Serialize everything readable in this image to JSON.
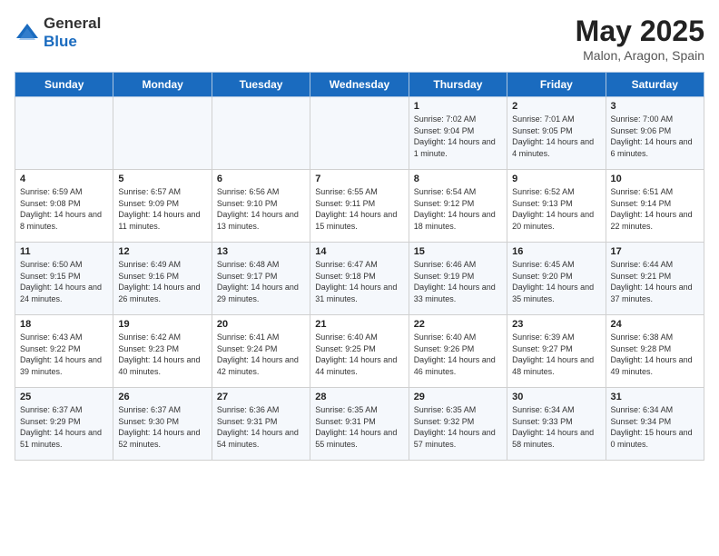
{
  "header": {
    "logo_general": "General",
    "logo_blue": "Blue",
    "title": "May 2025",
    "subtitle": "Malon, Aragon, Spain"
  },
  "days_of_week": [
    "Sunday",
    "Monday",
    "Tuesday",
    "Wednesday",
    "Thursday",
    "Friday",
    "Saturday"
  ],
  "weeks": [
    [
      {
        "day": "",
        "info": ""
      },
      {
        "day": "",
        "info": ""
      },
      {
        "day": "",
        "info": ""
      },
      {
        "day": "",
        "info": ""
      },
      {
        "day": "1",
        "info": "Sunrise: 7:02 AM\nSunset: 9:04 PM\nDaylight: 14 hours and 1 minute."
      },
      {
        "day": "2",
        "info": "Sunrise: 7:01 AM\nSunset: 9:05 PM\nDaylight: 14 hours and 4 minutes."
      },
      {
        "day": "3",
        "info": "Sunrise: 7:00 AM\nSunset: 9:06 PM\nDaylight: 14 hours and 6 minutes."
      }
    ],
    [
      {
        "day": "4",
        "info": "Sunrise: 6:59 AM\nSunset: 9:08 PM\nDaylight: 14 hours and 8 minutes."
      },
      {
        "day": "5",
        "info": "Sunrise: 6:57 AM\nSunset: 9:09 PM\nDaylight: 14 hours and 11 minutes."
      },
      {
        "day": "6",
        "info": "Sunrise: 6:56 AM\nSunset: 9:10 PM\nDaylight: 14 hours and 13 minutes."
      },
      {
        "day": "7",
        "info": "Sunrise: 6:55 AM\nSunset: 9:11 PM\nDaylight: 14 hours and 15 minutes."
      },
      {
        "day": "8",
        "info": "Sunrise: 6:54 AM\nSunset: 9:12 PM\nDaylight: 14 hours and 18 minutes."
      },
      {
        "day": "9",
        "info": "Sunrise: 6:52 AM\nSunset: 9:13 PM\nDaylight: 14 hours and 20 minutes."
      },
      {
        "day": "10",
        "info": "Sunrise: 6:51 AM\nSunset: 9:14 PM\nDaylight: 14 hours and 22 minutes."
      }
    ],
    [
      {
        "day": "11",
        "info": "Sunrise: 6:50 AM\nSunset: 9:15 PM\nDaylight: 14 hours and 24 minutes."
      },
      {
        "day": "12",
        "info": "Sunrise: 6:49 AM\nSunset: 9:16 PM\nDaylight: 14 hours and 26 minutes."
      },
      {
        "day": "13",
        "info": "Sunrise: 6:48 AM\nSunset: 9:17 PM\nDaylight: 14 hours and 29 minutes."
      },
      {
        "day": "14",
        "info": "Sunrise: 6:47 AM\nSunset: 9:18 PM\nDaylight: 14 hours and 31 minutes."
      },
      {
        "day": "15",
        "info": "Sunrise: 6:46 AM\nSunset: 9:19 PM\nDaylight: 14 hours and 33 minutes."
      },
      {
        "day": "16",
        "info": "Sunrise: 6:45 AM\nSunset: 9:20 PM\nDaylight: 14 hours and 35 minutes."
      },
      {
        "day": "17",
        "info": "Sunrise: 6:44 AM\nSunset: 9:21 PM\nDaylight: 14 hours and 37 minutes."
      }
    ],
    [
      {
        "day": "18",
        "info": "Sunrise: 6:43 AM\nSunset: 9:22 PM\nDaylight: 14 hours and 39 minutes."
      },
      {
        "day": "19",
        "info": "Sunrise: 6:42 AM\nSunset: 9:23 PM\nDaylight: 14 hours and 40 minutes."
      },
      {
        "day": "20",
        "info": "Sunrise: 6:41 AM\nSunset: 9:24 PM\nDaylight: 14 hours and 42 minutes."
      },
      {
        "day": "21",
        "info": "Sunrise: 6:40 AM\nSunset: 9:25 PM\nDaylight: 14 hours and 44 minutes."
      },
      {
        "day": "22",
        "info": "Sunrise: 6:40 AM\nSunset: 9:26 PM\nDaylight: 14 hours and 46 minutes."
      },
      {
        "day": "23",
        "info": "Sunrise: 6:39 AM\nSunset: 9:27 PM\nDaylight: 14 hours and 48 minutes."
      },
      {
        "day": "24",
        "info": "Sunrise: 6:38 AM\nSunset: 9:28 PM\nDaylight: 14 hours and 49 minutes."
      }
    ],
    [
      {
        "day": "25",
        "info": "Sunrise: 6:37 AM\nSunset: 9:29 PM\nDaylight: 14 hours and 51 minutes."
      },
      {
        "day": "26",
        "info": "Sunrise: 6:37 AM\nSunset: 9:30 PM\nDaylight: 14 hours and 52 minutes."
      },
      {
        "day": "27",
        "info": "Sunrise: 6:36 AM\nSunset: 9:31 PM\nDaylight: 14 hours and 54 minutes."
      },
      {
        "day": "28",
        "info": "Sunrise: 6:35 AM\nSunset: 9:31 PM\nDaylight: 14 hours and 55 minutes."
      },
      {
        "day": "29",
        "info": "Sunrise: 6:35 AM\nSunset: 9:32 PM\nDaylight: 14 hours and 57 minutes."
      },
      {
        "day": "30",
        "info": "Sunrise: 6:34 AM\nSunset: 9:33 PM\nDaylight: 14 hours and 58 minutes."
      },
      {
        "day": "31",
        "info": "Sunrise: 6:34 AM\nSunset: 9:34 PM\nDaylight: 15 hours and 0 minutes."
      }
    ]
  ]
}
